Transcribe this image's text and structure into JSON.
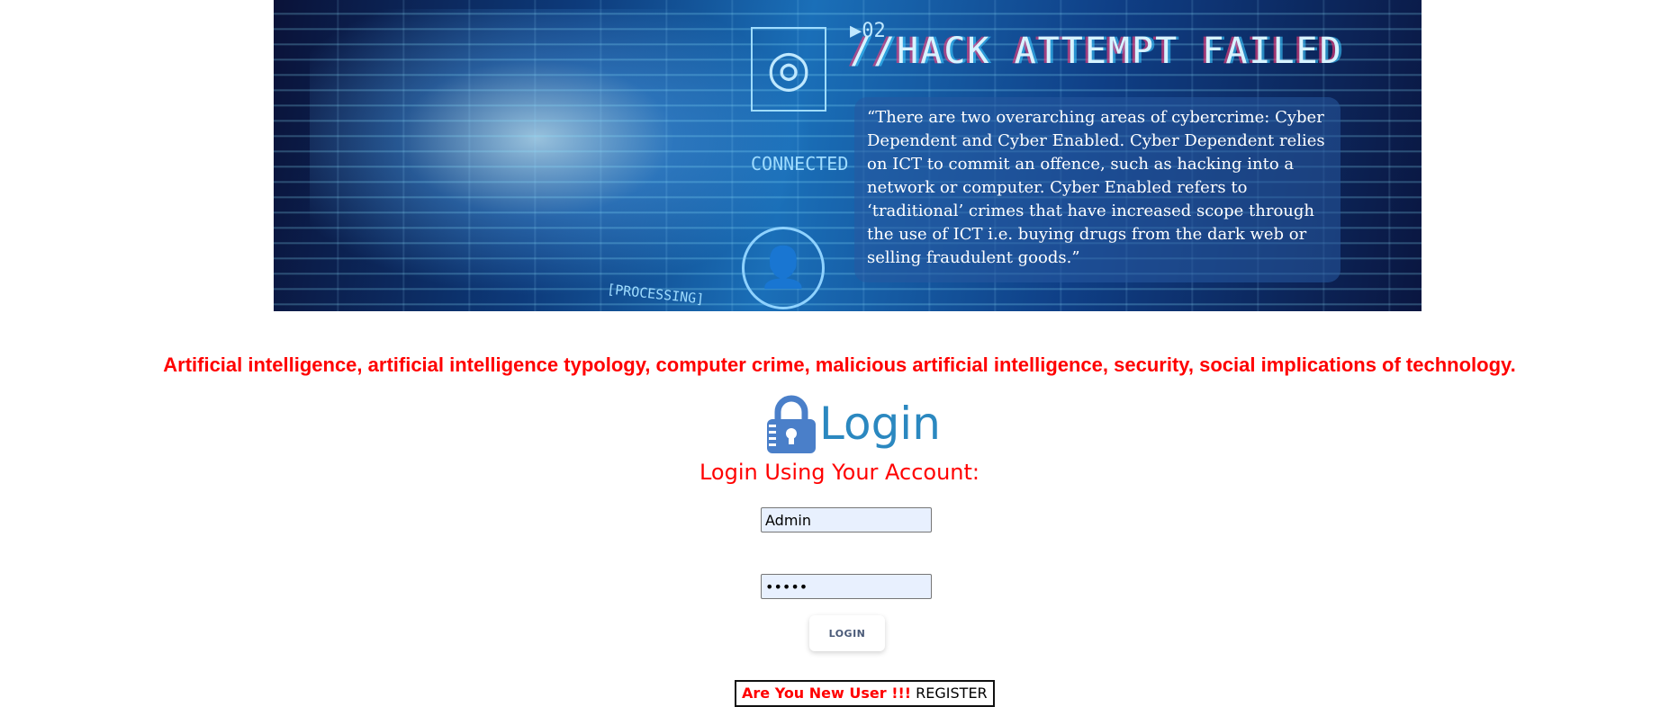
{
  "banner": {
    "code_label": "▶02",
    "headline": "//HACK ATTEMPT FAILED",
    "connected_label": "CONNECTED",
    "processing_label": "[PROCESSING]",
    "quote": "“There are two overarching areas of cybercrime: Cyber Dependent and Cyber Enabled.  Cyber Dependent relies on ICT to commit an offence, such as hacking into a network or computer. Cyber Enabled refers to ‘traditional’ crimes that have increased scope through the use of ICT i.e. buying drugs from the dark web or selling fraudulent goods.”"
  },
  "tagline": "Artificial intelligence, artificial intelligence typology, computer crime, malicious artificial intelligence, security, social implications of technology.",
  "login": {
    "heading": "Login",
    "subtitle": "Login Using Your Account:",
    "username_value": "Admin",
    "password_value": "•••••",
    "button_label": "LOGIN"
  },
  "register": {
    "prompt": "Are You New User !!!",
    "link_label": "REGISTER"
  },
  "colors": {
    "accent_red": "#ff0000",
    "login_blue": "#2b88c0",
    "lock_blue": "#4a7fc9",
    "input_bg": "#e8f0fe"
  },
  "icons": {
    "lock": "lock-icon",
    "fingerprint": "fingerprint-icon",
    "user_add": "user-add-icon"
  }
}
